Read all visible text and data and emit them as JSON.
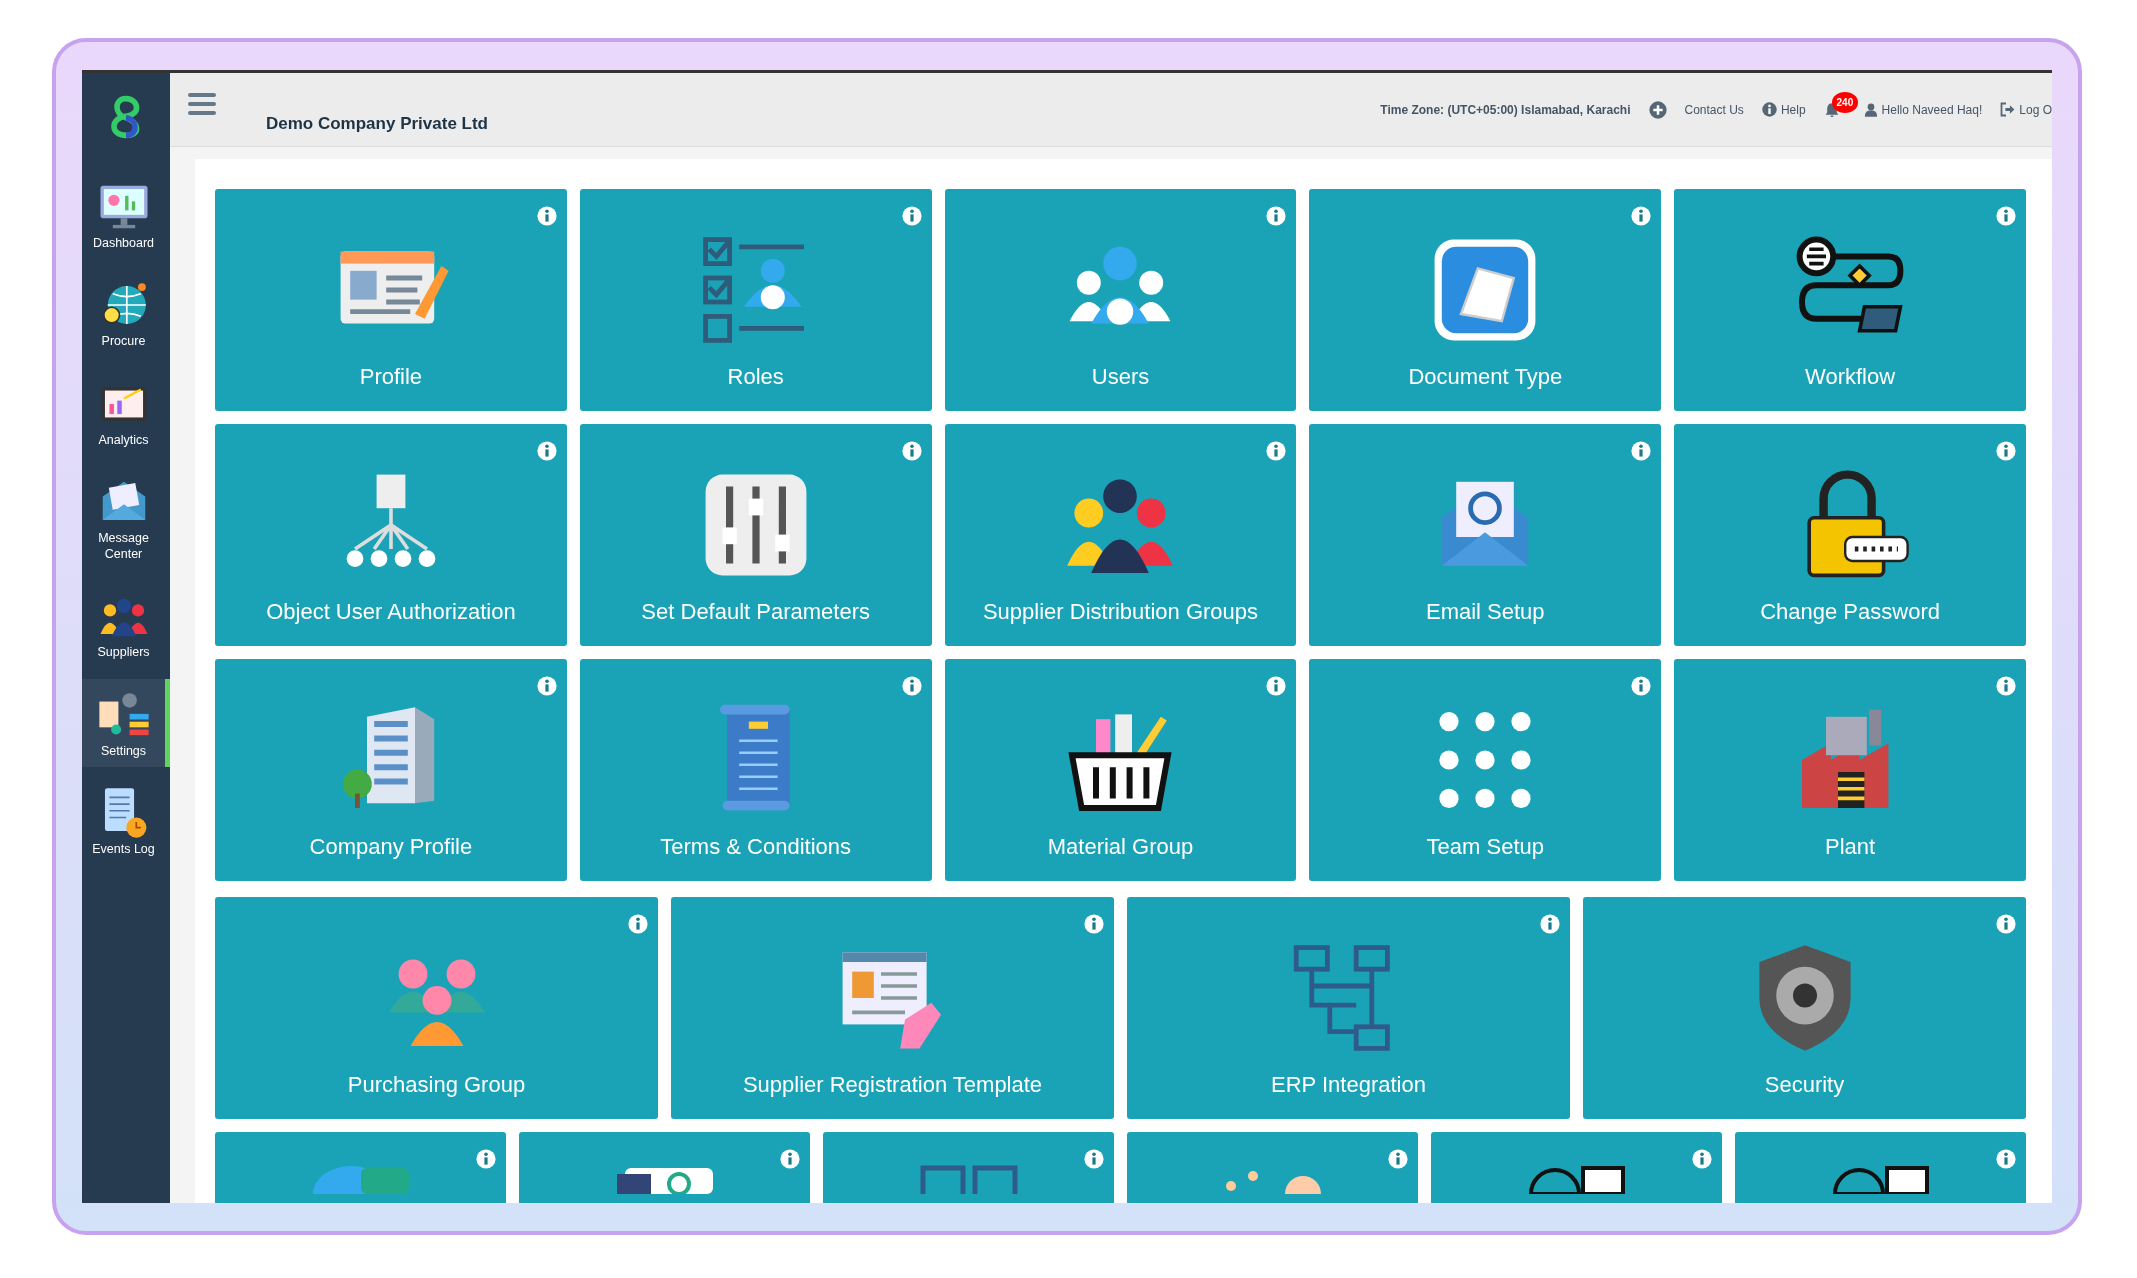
{
  "sidebar": {
    "items": [
      {
        "label": "Dashboard",
        "selected": false
      },
      {
        "label": "Procure",
        "selected": false
      },
      {
        "label": "Analytics",
        "selected": false
      },
      {
        "label": "Message Center",
        "selected": false
      },
      {
        "label": "Suppliers",
        "selected": false
      },
      {
        "label": "Settings",
        "selected": true
      },
      {
        "label": "Events Log",
        "selected": false
      }
    ]
  },
  "header": {
    "company": "Demo Company Private Ltd",
    "time_zone": "Time Zone: (UTC+05:00) Islamabad, Karachi",
    "contact": "Contact Us",
    "help": "Help",
    "notification_count": "240",
    "greeting": "Hello Naveed Haq!",
    "logout": "Log O"
  },
  "tile_rows": [
    {
      "tiles": [
        {
          "label": "Profile",
          "info": true
        },
        {
          "label": "Roles",
          "info": true
        },
        {
          "label": "Users",
          "info": true
        },
        {
          "label": "Document Type",
          "info": true
        },
        {
          "label": "Workflow",
          "info": true
        }
      ]
    },
    {
      "tiles": [
        {
          "label": "Object User Authorization",
          "info": true
        },
        {
          "label": "Set Default Parameters",
          "info": true
        },
        {
          "label": "Supplier Distribution Groups",
          "info": true
        },
        {
          "label": "Email Setup",
          "info": true
        },
        {
          "label": "Change Password",
          "info": true
        }
      ]
    },
    {
      "tiles": [
        {
          "label": "Company Profile",
          "info": true
        },
        {
          "label": "Terms & Conditions",
          "info": true
        },
        {
          "label": "Material Group",
          "info": true
        },
        {
          "label": "Team Setup",
          "info": true
        },
        {
          "label": "Plant",
          "info": true
        }
      ]
    },
    {
      "tiles": [
        {
          "label": "Purchasing Group",
          "info": true
        },
        {
          "label": "Supplier Registration Template",
          "info": true
        },
        {
          "label": "ERP Integration",
          "info": true
        },
        {
          "label": "Security",
          "info": true
        }
      ]
    },
    {
      "tiles": [
        {
          "info": true
        },
        {
          "info": true
        },
        {
          "info": true
        },
        {
          "info": true
        },
        {
          "info": true
        },
        {
          "info": true
        }
      ]
    }
  ]
}
